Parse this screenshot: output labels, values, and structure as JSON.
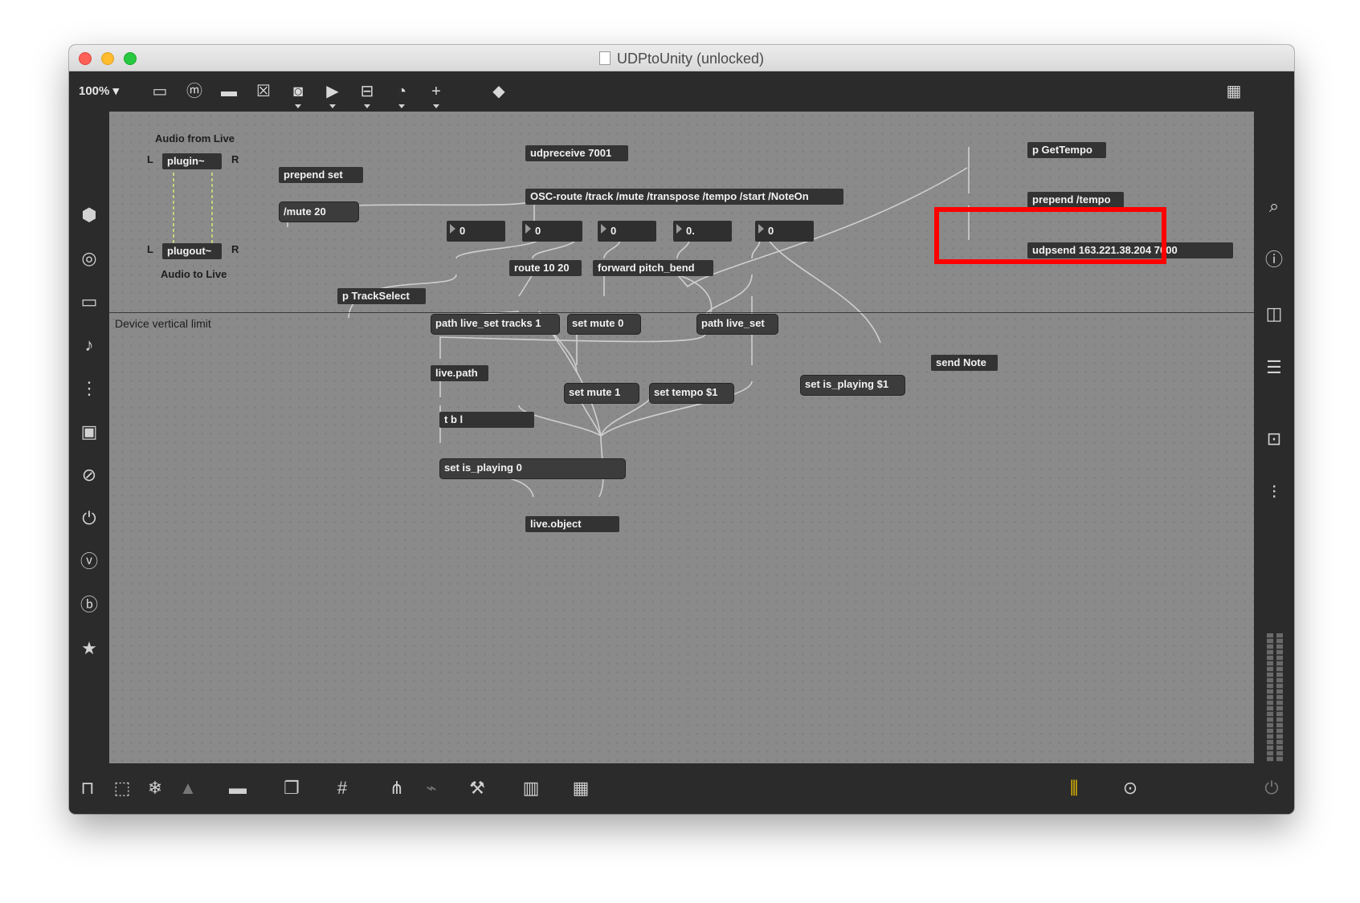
{
  "window": {
    "title": "UDPtoUnity (unlocked)"
  },
  "toolbar": {
    "zoom": "100%",
    "icons": [
      "new-object-icon",
      "message-icon",
      "comment-icon",
      "toggle-icon",
      "button-icon",
      "playbar-icon",
      "slider-icon",
      "dial-icon",
      "add-icon",
      "paint-bucket-icon",
      "grid-icon"
    ]
  },
  "left_sidebar": [
    "cube-icon",
    "target-icon",
    "device-icon",
    "music-note-icon",
    "sequence-icon",
    "image-icon",
    "paperclip-icon",
    "plug-icon",
    "v-badge-icon",
    "b-badge-icon",
    "star-icon"
  ],
  "right_sidebar": [
    "search-icon",
    "info-icon",
    "columns-icon",
    "list-icon",
    "snapshot-icon",
    "mixer-icon"
  ],
  "bottom_bar": [
    "lock-icon",
    "presentation-icon",
    "freeze-icon",
    "warning-icon",
    "comment-icon",
    "stack-icon",
    "grid-icon",
    "hierarchy-icon",
    "link-icon",
    "wrench-icon",
    "piano-icon",
    "keyboard-icon",
    "meter-icon",
    "transport-icon",
    "power-icon"
  ],
  "patch": {
    "audio_from_live": "Audio from Live",
    "audio_to_live": "Audio to Live",
    "plugin_label": "plugin~",
    "plugout_label": "plugout~",
    "left_channel": "L",
    "right_channel": "R",
    "device_limit": "Device vertical limit",
    "objects": {
      "udpreceive": "udpreceive 7001",
      "osc_route": "OSC-route /track /mute /transpose /tempo /start /NoteOn",
      "prepend_set": "prepend set",
      "mute20": "/mute 20",
      "num1": "0",
      "num2": "0",
      "num3": "0",
      "num4": "0.",
      "num5": "0",
      "route": "route 10 20",
      "forward": "forward pitch_bend",
      "trackselect": "p TrackSelect",
      "path_tracks": "path live_set tracks 1",
      "set_mute0": "set mute 0",
      "path_liveset": "path live_set",
      "send_note": "send Note",
      "live_path": "live.path",
      "set_mute1": "set mute 1",
      "set_tempo": "set tempo $1",
      "set_isplaying_arg": "set is_playing $1",
      "tbl": "t b l",
      "set_isplaying0": "set is_playing 0",
      "live_object": "live.object",
      "get_tempo": "p GetTempo",
      "prepend_tempo": "prepend /tempo",
      "udpsend": "udpsend 163.221.38.204 7000"
    }
  },
  "colors": {
    "highlight": "#ff0000",
    "canvas": "#8a8a8a",
    "object": "#333333",
    "meter_accent": "#f2c500"
  }
}
